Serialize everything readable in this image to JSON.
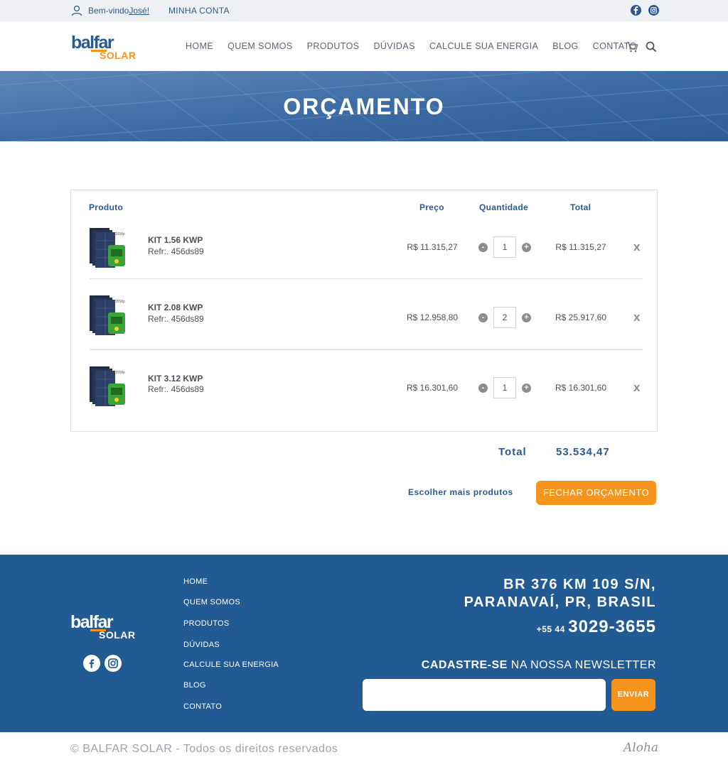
{
  "topbar": {
    "welcome_prefix": "Bem-vindo ",
    "user_name": "José!",
    "account_link": "MINHA CONTA"
  },
  "brand": {
    "logo_top": "balfar",
    "logo_bottom": "SOLAR",
    "primary_color": "#2b5a91",
    "accent_color": "#f7941d"
  },
  "nav": {
    "items": [
      "HOME",
      "QUEM SOMOS",
      "PRODUTOS",
      "DÚVIDAS",
      "CALCULE SUA ENERGIA",
      "BLOG",
      "CONTATO"
    ]
  },
  "banner": {
    "title": "ORÇAMENTO"
  },
  "cart": {
    "headers": {
      "product": "Produto",
      "price": "Preço",
      "quantity": "Quantidade",
      "total": "Total"
    },
    "items": [
      {
        "name": "KIT 1.56 KWP",
        "ref": "Refr:. 456ds89",
        "price": "R$ 11.315,27",
        "qty": "1",
        "total": "R$ 11.315,27",
        "remove": "x"
      },
      {
        "name": "KIT 2.08 KWP",
        "ref": "Refr:. 456ds89",
        "price": "R$ 12.958,80",
        "qty": "2",
        "total": "R$ 25.917,60",
        "remove": "x"
      },
      {
        "name": "KIT 3.12 KWP",
        "ref": "Refr:. 456ds89",
        "price": "R$ 16.301,60",
        "qty": "1",
        "total": "R$ 16.301,60",
        "remove": "x"
      }
    ],
    "minus_label": "-",
    "plus_label": "+",
    "sum_label": "Total",
    "sum_value": "53.534,47",
    "more_products": "Escolher mais produtos",
    "checkout": "FECHAR ORÇAMENTO"
  },
  "footer": {
    "nav": [
      "HOME",
      "QUEM SOMOS",
      "PRODUTOS",
      "DÚVIDAS",
      "CALCULE SUA ENERGIA",
      "BLOG",
      "CONTATO"
    ],
    "address_line1": "BR 376 KM 109 S/N,",
    "address_line2": "PARANAVAÍ, PR,  BRASIL",
    "phone_ddd": "+55 44",
    "phone_number": "3029-3655",
    "newsletter_bold": "CADASTRE-SE",
    "newsletter_rest": " NA NOSSA NEWSLETTER",
    "newsletter_button": "ENVIAR"
  },
  "copyright": "© BALFAR SOLAR - Todos os direitos reservados",
  "credit": "Aloha",
  "icons": {
    "user": "user-icon",
    "facebook": "facebook-icon",
    "instagram": "instagram-icon",
    "cart": "cart-icon",
    "search": "search-icon",
    "product": "solar-kit-thumbnail"
  }
}
